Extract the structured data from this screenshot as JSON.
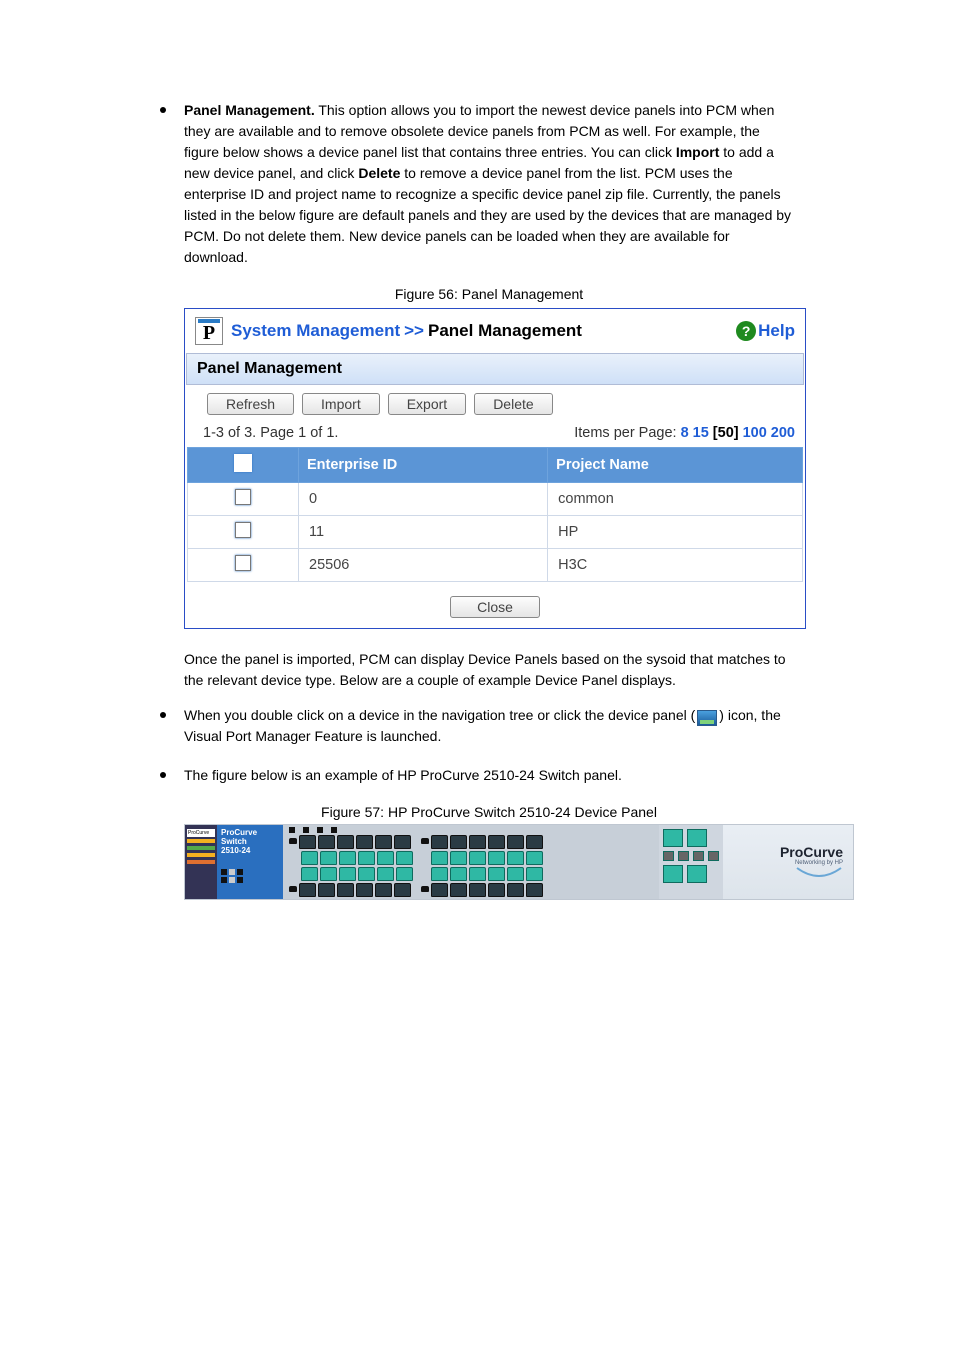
{
  "bullet1": {
    "head": "Panel Management.",
    "body1": " This option allows you to import the newest device panels into PCM when they are available and to remove obsolete device panels from PCM as well. For example, the figure below shows a device panel list that contains three entries. You can click ",
    "import_w": "Import",
    "body2": " to add a new device panel, and click ",
    "delete_w": "Delete",
    "body3": " to remove a device panel from the list. PCM uses the enterprise ID and project name to recognize a specific device panel zip file. Currently, the panels listed in the below figure are default panels and they are used by the devices that are managed by PCM. Do not delete them. New device panels can be loaded when they are available for download."
  },
  "panel": {
    "breadcrumb": {
      "a": "System Management",
      "sep": ">>",
      "b": "Panel Management"
    },
    "help": "Help",
    "section_title": "Panel Management",
    "buttons": {
      "refresh": "Refresh",
      "import": "Import",
      "export": "Export",
      "delete": "Delete"
    },
    "pager": {
      "left": "1-3 of 3. Page 1 of 1.",
      "label": "Items per Page:",
      "opts": [
        "8",
        "15",
        "50",
        "100",
        "200"
      ],
      "selected_index": 2
    },
    "columns": {
      "c1": "Enterprise ID",
      "c2": "Project Name"
    },
    "rows": [
      {
        "id": "0",
        "name": "common"
      },
      {
        "id": "11",
        "name": "HP"
      },
      {
        "id": "25506",
        "name": "H3C"
      }
    ],
    "close": "Close"
  },
  "figcap1": "Figure 56: Panel Management",
  "after_text": "Once the panel is imported, PCM can display Device Panels based on the sysoid that matches to the relevant device type. Below are a couple of example Device Panel displays.",
  "bullet2": {
    "text1": "When you double click on a device in the navigation tree or click the device panel (",
    "text2": ") icon, the Visual Port Manager Feature is launched."
  },
  "bullet3": {
    "text": "The figure below is an example of HP ProCurve 2510-24 Switch panel."
  },
  "figcap2": "Figure 57: HP ProCurve Switch 2510-24 Device Panel",
  "device": {
    "model_line1": "ProCurve Switch",
    "model_line2": "2510-24",
    "brand": "ProCurve",
    "brand_sub": "Networking by HP"
  }
}
